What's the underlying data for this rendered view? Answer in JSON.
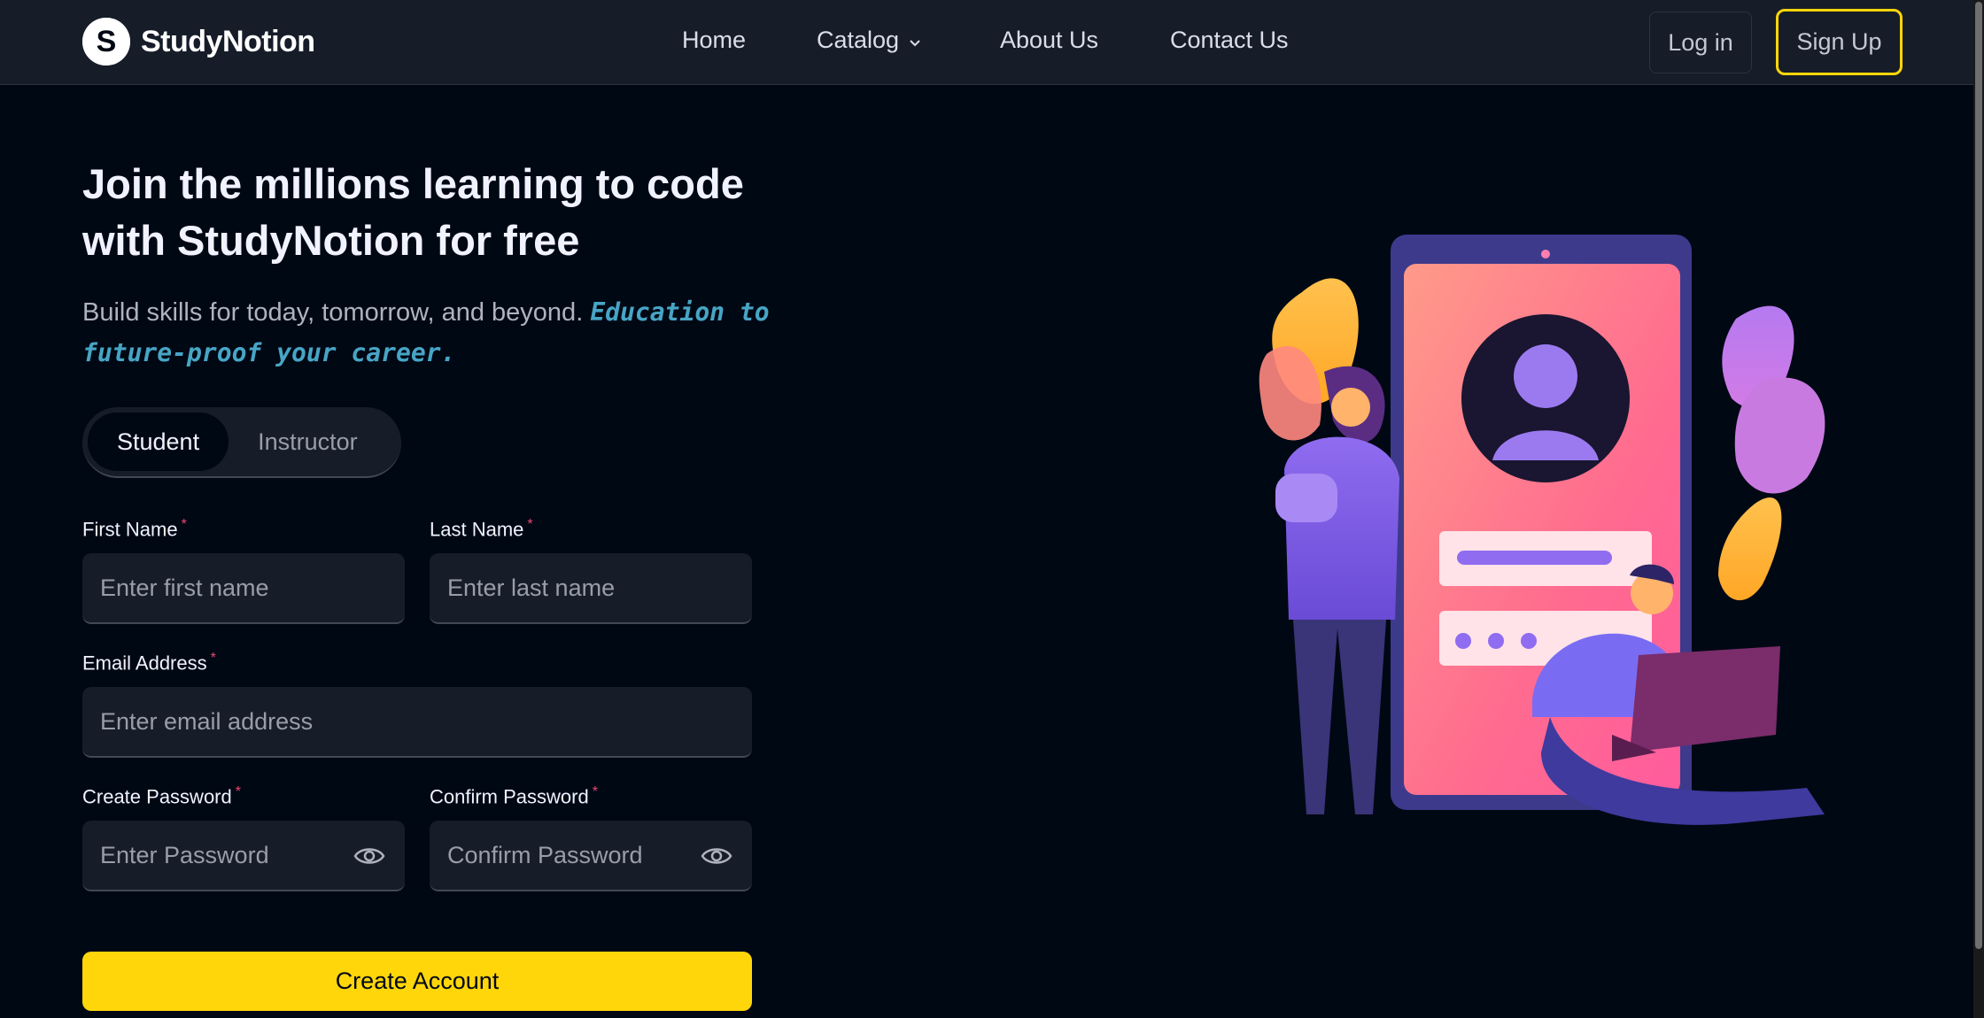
{
  "brand": {
    "name": "StudyNotion",
    "logo_letter": "S"
  },
  "nav": {
    "links": [
      "Home",
      "Catalog",
      "About Us",
      "Contact Us"
    ],
    "login": "Log in",
    "signup": "Sign Up"
  },
  "hero": {
    "title": "Join the millions learning to code with StudyNotion for free",
    "subtitle": "Build skills for today, tomorrow, and beyond.",
    "subtitle_accent": "Education to future-proof your career."
  },
  "role_toggle": {
    "options": [
      "Student",
      "Instructor"
    ],
    "selected": "Student"
  },
  "form": {
    "first_name": {
      "label": "First Name",
      "required_mark": "*",
      "placeholder": "Enter first name",
      "value": ""
    },
    "last_name": {
      "label": "Last Name",
      "required_mark": "*",
      "placeholder": "Enter last name",
      "value": ""
    },
    "email": {
      "label": "Email Address",
      "required_mark": "*",
      "placeholder": "Enter email address",
      "value": ""
    },
    "password": {
      "label": "Create Password",
      "required_mark": "*",
      "placeholder": "Enter Password",
      "value": ""
    },
    "confirm_password": {
      "label": "Confirm Password",
      "required_mark": "*",
      "placeholder": "Confirm Password",
      "value": ""
    },
    "submit": "Create Account"
  },
  "colors": {
    "background": "#000814",
    "surface": "#161d29",
    "accent_yellow": "#ffd60a",
    "accent_blue": "#47a5c5",
    "required_pink": "#ef476f"
  },
  "icons": {
    "password_toggle": "eye-icon",
    "catalog_dropdown": "chevron-down-icon"
  }
}
